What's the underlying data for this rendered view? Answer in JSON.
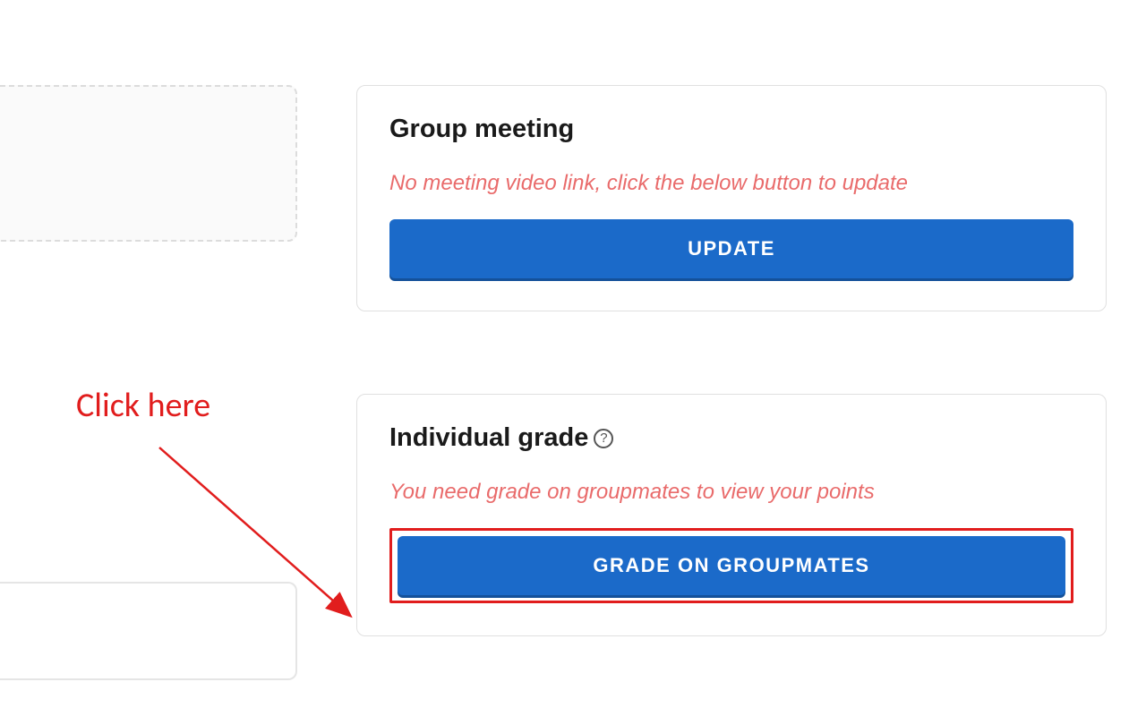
{
  "group_meeting": {
    "title": "Group meeting",
    "warning": "No meeting video link, click the below button to update",
    "button_label": "UPDATE"
  },
  "individual_grade": {
    "title": "Individual grade",
    "help_symbol": "?",
    "warning": "You need grade on groupmates to view your points",
    "button_label": "GRADE ON GROUPMATES"
  },
  "annotation": {
    "text": "Click here"
  }
}
